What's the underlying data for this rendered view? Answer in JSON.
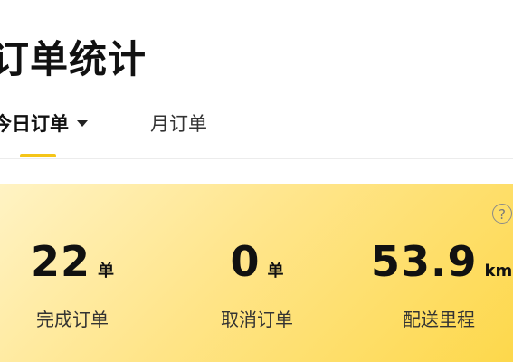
{
  "header": {
    "title": "订单统计"
  },
  "tabs": [
    {
      "label": "今日订单",
      "active": true,
      "has_dropdown": true
    },
    {
      "label": "月订单",
      "active": false
    }
  ],
  "help_icon": {
    "glyph": "?",
    "icon": "question-circle-icon"
  },
  "stats": {
    "completed": {
      "value": "22",
      "unit": "单",
      "label": "完成订单"
    },
    "cancelled": {
      "value": "0",
      "unit": "单",
      "label": "取消订单"
    },
    "distance": {
      "value": "53.9",
      "unit": "km",
      "label": "配送里程"
    }
  },
  "colors": {
    "accent": "#f5c518",
    "card_gradient_start": "#fff3c4",
    "card_gradient_end": "#fdd84b"
  }
}
